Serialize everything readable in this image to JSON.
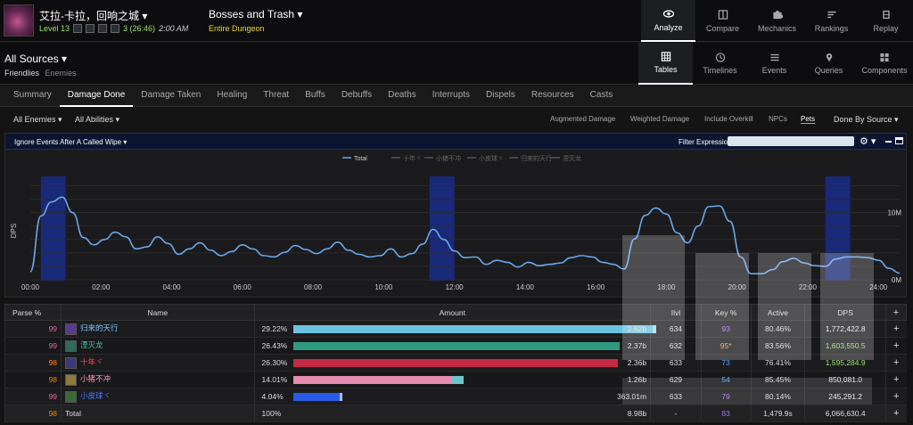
{
  "header": {
    "zone_title": "艾拉-卡拉，回响之城 ▾",
    "level": "Level 13",
    "keys": "3 (26:46)",
    "time": "2:00 AM",
    "fight_title": "Bosses and Trash ▾",
    "fight_sub": "Entire Dungeon",
    "nav": [
      {
        "label": "Analyze",
        "icon": "eye-icon",
        "active": true
      },
      {
        "label": "Compare",
        "icon": "compare-icon",
        "active": false
      },
      {
        "label": "Mechanics",
        "icon": "puzzle-icon",
        "active": false
      },
      {
        "label": "Rankings",
        "icon": "rankings-icon",
        "active": false
      },
      {
        "label": "Replay",
        "icon": "film-icon",
        "active": false
      }
    ]
  },
  "sources": {
    "title": "All Sources ▾",
    "friendlies": "Friendlies",
    "enemies": "Enemies",
    "views": [
      {
        "label": "Tables",
        "icon": "grid-icon",
        "active": true
      },
      {
        "label": "Timelines",
        "icon": "clock-icon",
        "active": false
      },
      {
        "label": "Events",
        "icon": "list-icon",
        "active": false
      },
      {
        "label": "Queries",
        "icon": "pin-icon",
        "active": false
      },
      {
        "label": "Components",
        "icon": "components-icon",
        "active": false
      }
    ]
  },
  "tabs": [
    "Summary",
    "Damage Done",
    "Damage Taken",
    "Healing",
    "Threat",
    "Buffs",
    "Debuffs",
    "Deaths",
    "Interrupts",
    "Dispels",
    "Resources",
    "Casts"
  ],
  "filters": {
    "enemies": "All Enemies ▾",
    "abilities": "All Abilities ▾",
    "options": [
      "Augmented Damage",
      "Weighted Damage",
      "Include Overkill",
      "NPCs",
      "Pets"
    ],
    "done_by": "Done By Source ▾"
  },
  "panel": {
    "ignore": "Ignore Events After A Called Wipe ▾",
    "filter_label": "Filter Expression:",
    "filter_value": "",
    "gear": "⚙ ▾"
  },
  "chart_data": {
    "type": "line",
    "legend": [
      "Total",
      "十年ヾ",
      "小猪不冲",
      "小皮球ヾ",
      "归来的天行",
      "湮灭龙"
    ],
    "yaxis_label": "DPS",
    "y_ticks": [
      "10M",
      "0M"
    ],
    "x_ticks": [
      "00:00",
      "02:00",
      "04:00",
      "06:00",
      "08:00",
      "10:00",
      "12:00",
      "14:00",
      "16:00",
      "18:00",
      "20:00",
      "22:00",
      "24:00"
    ],
    "x_minutes": [
      0,
      0.3,
      0.6,
      0.9,
      1.2,
      1.5,
      1.8,
      2.1,
      2.4,
      2.7,
      3.0,
      3.3,
      3.6,
      3.9,
      4.2,
      4.5,
      4.8,
      5.1,
      5.4,
      5.7,
      6.0,
      6.3,
      6.6,
      6.9,
      7.2,
      7.5,
      7.8,
      8.1,
      8.4,
      8.7,
      9.0,
      9.3,
      9.6,
      9.9,
      10.2,
      10.5,
      10.8,
      11.1,
      11.4,
      11.7,
      12.0,
      12.3,
      12.6,
      12.9,
      13.2,
      13.5,
      13.8,
      14.1,
      14.4,
      14.7,
      15.0,
      15.3,
      15.6,
      15.9,
      16.2,
      16.5,
      16.8,
      17.1,
      17.4,
      17.7,
      18.0,
      18.3,
      18.6,
      18.9,
      19.2,
      19.5,
      19.8,
      20.1,
      20.4,
      20.7,
      21.0,
      21.3,
      21.6,
      21.9,
      22.2,
      22.5,
      22.8,
      23.1,
      23.4,
      23.7,
      24.0,
      24.3,
      24.6
    ],
    "total_dps_m": [
      1.2,
      9.5,
      11.6,
      12.3,
      10.0,
      6.3,
      5.2,
      6.0,
      7.1,
      6.4,
      4.6,
      4.9,
      6.4,
      5.4,
      3.8,
      4.6,
      5.5,
      4.4,
      3.6,
      4.2,
      5.2,
      4.6,
      3.6,
      3.4,
      4.1,
      5.1,
      4.5,
      3.9,
      4.6,
      5.6,
      4.4,
      3.8,
      3.4,
      3.6,
      4.6,
      3.4,
      3.9,
      5.3,
      7.5,
      6.0,
      4.3,
      3.3,
      3.4,
      2.3,
      2.9,
      2.6,
      1.9,
      2.6,
      2.1,
      2.3,
      2.5,
      3.3,
      3.6,
      3.4,
      2.6,
      2.3,
      1.6,
      6.1,
      9.6,
      10.7,
      9.8,
      7.0,
      5.5,
      8.0,
      10.9,
      11.0,
      8.7,
      3.4,
      0.9,
      0.9,
      1.5,
      2.7,
      3.2,
      2.5,
      2.1,
      2.0,
      3.1,
      3.4,
      3.4,
      3.3,
      2.9,
      1.7,
      1.0
    ],
    "highlight_ranges_min": [
      [
        0.3,
        1.0
      ],
      [
        11.3,
        12.0
      ],
      [
        22.5,
        23.2
      ]
    ],
    "ylim": [
      0,
      15
    ],
    "xlim": [
      0,
      24.6
    ]
  },
  "table": {
    "headers": [
      "Parse %",
      "Name",
      "Amount",
      "Ilvl",
      "Key %",
      "Active",
      "DPS",
      "+"
    ],
    "rows": [
      {
        "parse": "99",
        "name": "归来的天行",
        "pct": "29.22%",
        "frac": 1.0,
        "tail": 0.01,
        "amount": "2.62b",
        "ilvl": "634",
        "key": "93",
        "active": "80.46%",
        "dps": "1,772,422.8",
        "bar": "#6cc3e0",
        "tailColor": "#9fdcf0",
        "nameColor": "#7fc4ff",
        "dpsColor": "#e6e6e6",
        "keyColor": "#a66cf0",
        "specColor": "#5a3a8c"
      },
      {
        "parse": "99",
        "name": "湮灭龙",
        "pct": "26.43%",
        "frac": 0.905,
        "tail": 0.0,
        "amount": "2.37b",
        "ilvl": "632",
        "key": "95*",
        "active": "83.56%",
        "dps": "1,603,550.5",
        "bar": "#2f9a80",
        "tailColor": "#2f9a80",
        "nameColor": "#3fc7a8",
        "dpsColor": "#9be16c",
        "keyColor": "#ff9a30",
        "specColor": "#2f6a5a"
      },
      {
        "parse": "98",
        "name": "十年ヾ",
        "pct": "26.30%",
        "frac": 0.9,
        "tail": 0.0,
        "amount": "2.36b",
        "ilvl": "633",
        "key": "73",
        "active": "76.41%",
        "dps": "1,595,284.9",
        "bar": "#c42a44",
        "tailColor": "#c42a44",
        "nameColor": "#ff4a5a",
        "dpsColor": "#9be16c",
        "keyColor": "#4aa3ff",
        "specColor": "#3a3a7a"
      },
      {
        "parse": "98",
        "name": "小猪不冲",
        "pct": "14.01%",
        "frac": 0.44,
        "tail": 0.036,
        "amount": "1.26b",
        "ilvl": "629",
        "key": "54",
        "active": "85.45%",
        "dps": "850,081.0",
        "bar": "#e58ab0",
        "tailColor": "#6cc3c8",
        "nameColor": "#ff9ac0",
        "dpsColor": "#e6e6e6",
        "keyColor": "#4aa3ff",
        "specColor": "#8c7a3a"
      },
      {
        "parse": "99",
        "name": "小皮球ヾ",
        "pct": "4.04%",
        "frac": 0.13,
        "tail": 0.007,
        "amount": "363.01m",
        "ilvl": "633",
        "key": "79",
        "active": "80.14%",
        "dps": "245,291.2",
        "bar": "#2a5ae8",
        "tailColor": "#9fc0ff",
        "nameColor": "#4a7aff",
        "dpsColor": "#e6e6e6",
        "keyColor": "#a66cf0",
        "specColor": "#3a6a3a"
      }
    ],
    "total": {
      "parse": "98",
      "name": "Total",
      "pct": "100%",
      "amount": "8.98b",
      "ilvl": "-",
      "key": "83",
      "active": "1,479.9s",
      "dps": "6,066,630.4"
    }
  },
  "colors": {
    "accent": "#9be16c",
    "line": "#6aa8e8",
    "highlight": "#1a2a7a",
    "parse_99": "#e268a8",
    "parse_98": "#ff8000"
  }
}
